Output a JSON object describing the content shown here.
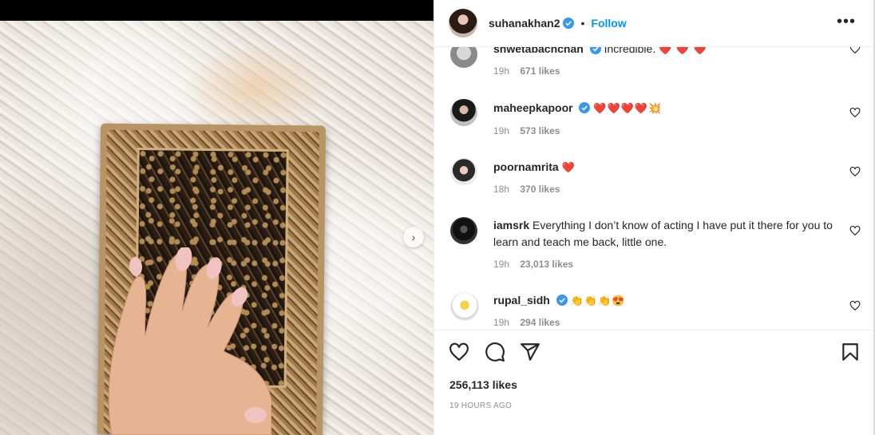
{
  "post": {
    "username": "suhanakhan2",
    "follow_label": "Follow",
    "separator": "•",
    "more_label": "•••",
    "likes": "256,113 likes",
    "timestamp": "19 HOURS AGO"
  },
  "comments": [
    {
      "username": "shwetabachchan",
      "verified": true,
      "text": "Incredible.",
      "emoji": "❤️ ❤️ ❤️",
      "time": "19h",
      "likes": "671 likes"
    },
    {
      "username": "maheepkapoor",
      "verified": true,
      "text": "",
      "emoji": "❤️❤️❤️❤️💥",
      "time": "19h",
      "likes": "573 likes"
    },
    {
      "username": "poornamrita",
      "verified": false,
      "text": "",
      "emoji": "❤️",
      "time": "18h",
      "likes": "370 likes"
    },
    {
      "username": "iamsrk",
      "verified": false,
      "text": "Everything I don’t know of acting I have put it there for you to learn and teach me back, little one.",
      "emoji": "",
      "time": "19h",
      "likes": "23,013 likes"
    },
    {
      "username": "rupal_sidh",
      "verified": true,
      "text": "",
      "emoji": "👏👏👏😍",
      "time": "19h",
      "likes": "294 likes"
    }
  ],
  "icons": {
    "like": "heart-icon",
    "comment": "comment-icon",
    "share": "share-icon",
    "save": "bookmark-icon",
    "verified": "verified-badge-icon",
    "next": "chevron-right-icon"
  },
  "colors": {
    "accent": "#0095f6",
    "verified": "#3897f0",
    "secondary_text": "#8e8e8e"
  }
}
